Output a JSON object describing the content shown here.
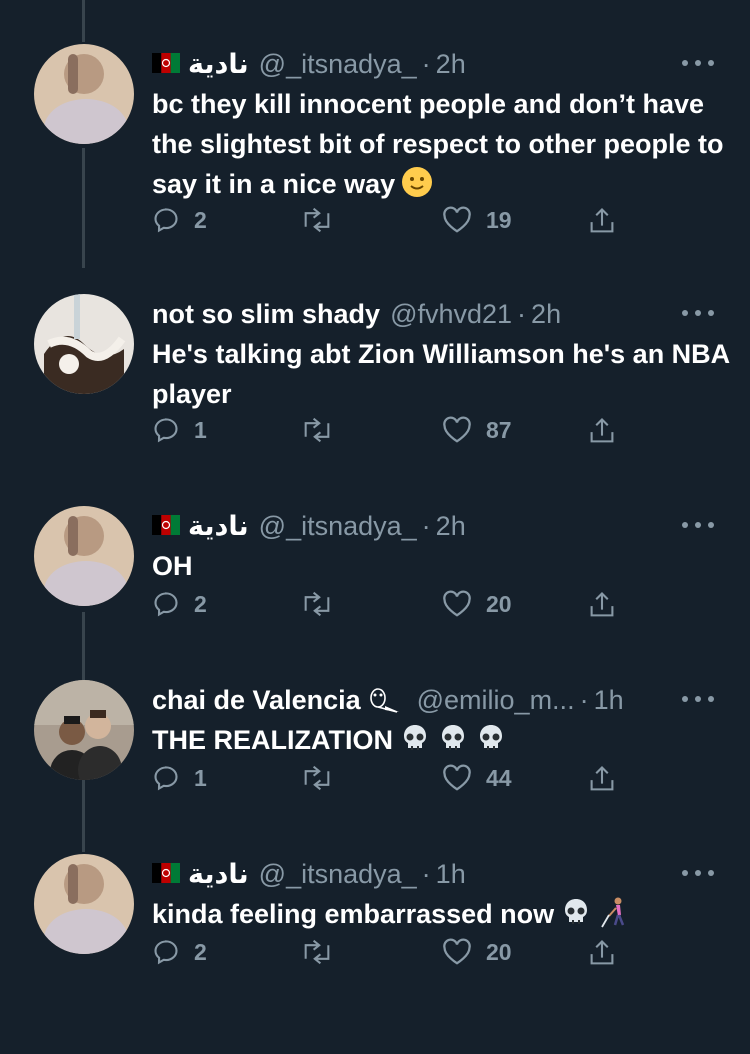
{
  "colors": {
    "background": "#15202b",
    "text": "#ffffff",
    "secondary_text": "#8899a6",
    "thread_line": "#38444d"
  },
  "tweets": [
    {
      "name": "نادية",
      "handle": "@_itsnadya_",
      "time": "2h",
      "text": "bc they kill innocent people and don’t have the slightest bit of respect to other people to say it in a nice way",
      "trailing_emoji": "slightly-smiling-face",
      "replies": "2",
      "retweets": "",
      "likes": "19"
    },
    {
      "name": "not so slim shady",
      "handle": "@fvhvd21",
      "time": "2h",
      "text": "He's talking abt Zion Williamson he's an NBA player",
      "replies": "1",
      "retweets": "",
      "likes": "87"
    },
    {
      "name": "نادية",
      "handle": "@_itsnadya_",
      "time": "2h",
      "text": "OH",
      "replies": "2",
      "retweets": "",
      "likes": "20"
    },
    {
      "name": "chai de Valencia",
      "handle": "@emilio_m...",
      "time": "1h",
      "text": "THE REALIZATION",
      "trailing_emoji": "skull x3",
      "replies": "1",
      "retweets": "",
      "likes": "44"
    },
    {
      "name": "نادية",
      "handle": "@_itsnadya_",
      "time": "1h",
      "text": "kinda feeling embarrassed now",
      "trailing_emoji": "skull, person-with-white-cane",
      "replies": "2",
      "retweets": "",
      "likes": "20"
    }
  ],
  "separator": "·"
}
